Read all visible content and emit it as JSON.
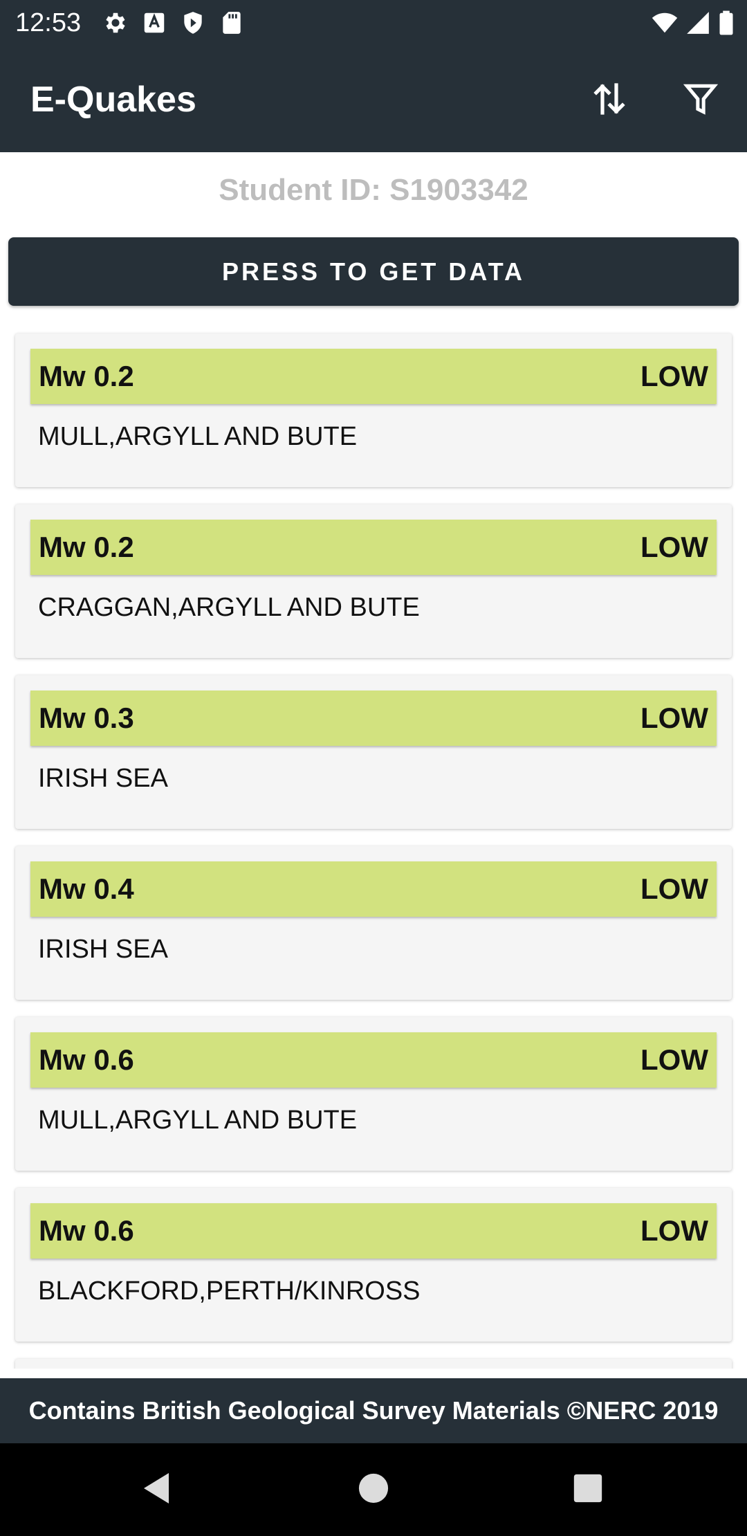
{
  "status_bar": {
    "time": "12:53",
    "icons": [
      "settings-icon",
      "text-recognition-icon",
      "shield-icon",
      "sd-card-icon",
      "wifi-icon",
      "signal-icon",
      "battery-icon"
    ]
  },
  "app_bar": {
    "title": "E-Quakes",
    "actions": [
      "sort-icon",
      "filter-icon"
    ]
  },
  "student_id": "Student ID: S1903342",
  "data_button_label": "PRESS TO GET DATA",
  "quakes": [
    {
      "magnitude": "Mw 0.2",
      "level": "LOW",
      "location": "MULL,ARGYLL AND BUTE"
    },
    {
      "magnitude": "Mw 0.2",
      "level": "LOW",
      "location": "CRAGGAN,ARGYLL AND BUTE"
    },
    {
      "magnitude": "Mw 0.3",
      "level": "LOW",
      "location": "IRISH SEA"
    },
    {
      "magnitude": "Mw 0.4",
      "level": "LOW",
      "location": "IRISH SEA"
    },
    {
      "magnitude": "Mw 0.6",
      "level": "LOW",
      "location": "MULL,ARGYLL AND BUTE"
    },
    {
      "magnitude": "Mw 0.6",
      "level": "LOW",
      "location": "BLACKFORD,PERTH/KINROSS"
    }
  ],
  "footer_text": "Contains British Geological Survey Materials ©NERC 2019",
  "colors": {
    "primary_dark": "#263038",
    "low_level": "#d2e27f",
    "card_background": "#f5f5f5",
    "student_id_text": "#bdbdbd"
  }
}
